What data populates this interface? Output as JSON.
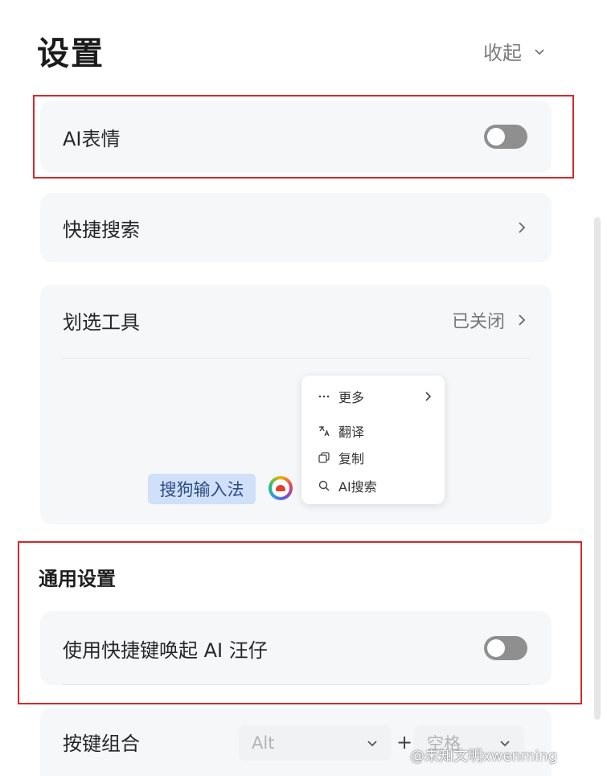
{
  "header": {
    "title": "设置",
    "collapse_label": "收起"
  },
  "ai_emoji": {
    "label": "AI表情",
    "enabled": false
  },
  "quick_search": {
    "label": "快捷搜索"
  },
  "selection_tool": {
    "label": "划选工具",
    "status": "已关闭",
    "preview": {
      "selected_text": "搜狗输入法",
      "menu": [
        {
          "icon": "more-icon",
          "label": "更多",
          "has_submenu": true
        },
        {
          "icon": "translate-icon",
          "label": "翻译"
        },
        {
          "icon": "copy-icon",
          "label": "复制"
        },
        {
          "icon": "search-icon",
          "label": "AI搜索"
        }
      ]
    }
  },
  "general": {
    "section_title": "通用设置",
    "hotkey_toggle": {
      "label": "使用快捷键唤起 AI 汪仔",
      "enabled": false
    },
    "key_combo": {
      "label": "按键组合",
      "modifier": "Alt",
      "plus": "+",
      "key": "空格"
    }
  },
  "watermark": {
    "text": "@未知文明xwenming"
  },
  "colors": {
    "highlight": "#d8262b",
    "card_bg": "#f6f7f9",
    "toggle_off": "#8f8f8f"
  }
}
